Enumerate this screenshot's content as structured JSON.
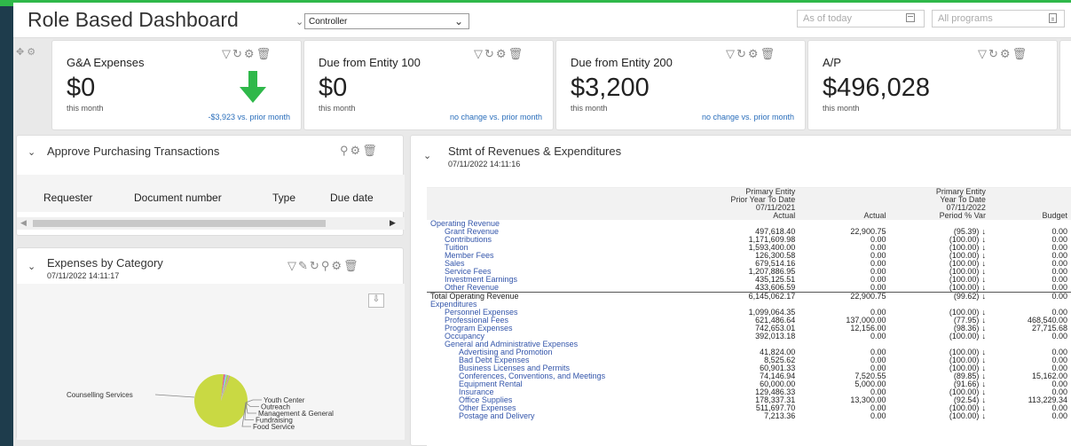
{
  "header": {
    "title": "Role Based Dashboard",
    "role_selected": "Controller",
    "date_placeholder": "As of today",
    "program_placeholder": "All programs"
  },
  "kpis": [
    {
      "title": "G&A Expenses",
      "value": "$0",
      "sub": "this month",
      "comparison": "-$3,923 vs. prior month",
      "trend": "down"
    },
    {
      "title": "Due from Entity 100",
      "value": "$0",
      "sub": "this month",
      "comparison": "no change vs. prior month"
    },
    {
      "title": "Due from Entity 200",
      "value": "$3,200",
      "sub": "this month",
      "comparison": "no change vs. prior month"
    },
    {
      "title": "A/P",
      "value": "$496,028",
      "sub": "this month",
      "comparison": ""
    }
  ],
  "approve_panel": {
    "title": "Approve Purchasing Transactions",
    "columns": [
      "Requester",
      "Document number",
      "Type",
      "Due date"
    ]
  },
  "expenses_panel": {
    "title": "Expenses by Category",
    "timestamp": "07/11/2022 14:11:17",
    "chart_data": {
      "type": "pie",
      "labels": [
        "Counselling Services",
        "Youth Center",
        "Outreach",
        "Management & General",
        "Fundraising",
        "Food Service"
      ],
      "values": [
        96,
        1,
        1,
        1,
        0.5,
        0.5
      ],
      "colors": [
        "#c9d943",
        "#e05a8a",
        "#8ec8f0",
        "#9fd15a",
        "#f0b24a",
        "#b07fd0"
      ]
    }
  },
  "stmt_panel": {
    "title": "Stmt of Revenues & Expenditures",
    "timestamp": "07/11/2022 14:11:16",
    "col_headers": {
      "c1": [
        "Primary Entity",
        "Prior Year To Date",
        "07/11/2021",
        "Actual"
      ],
      "c2": [
        "",
        "",
        "",
        "Actual"
      ],
      "c3": [
        "Primary Entity",
        "Year To Date",
        "07/11/2022",
        "Period % Var"
      ],
      "c4": [
        "",
        "",
        "",
        "Budget"
      ]
    },
    "rows": [
      {
        "label": "Operating Revenue",
        "indent": 0,
        "link": true,
        "c1": "",
        "c2": "",
        "c3": "",
        "c4": ""
      },
      {
        "label": "Grant Revenue",
        "indent": 1,
        "link": true,
        "c1": "497,618.40",
        "c2": "22,900.75",
        "c3": "(95.39)",
        "c4": "0.00",
        "arrow": true
      },
      {
        "label": "Contributions",
        "indent": 1,
        "link": true,
        "c1": "1,171,609.98",
        "c2": "0.00",
        "c3": "(100.00)",
        "c4": "0.00",
        "arrow": true
      },
      {
        "label": "Tuition",
        "indent": 1,
        "link": true,
        "c1": "1,593,400.00",
        "c2": "0.00",
        "c3": "(100.00)",
        "c4": "0.00",
        "arrow": true
      },
      {
        "label": "Member Fees",
        "indent": 1,
        "link": true,
        "c1": "126,300.58",
        "c2": "0.00",
        "c3": "(100.00)",
        "c4": "0.00",
        "arrow": true
      },
      {
        "label": "Sales",
        "indent": 1,
        "link": true,
        "c1": "679,514.16",
        "c2": "0.00",
        "c3": "(100.00)",
        "c4": "0.00",
        "arrow": true
      },
      {
        "label": "Service Fees",
        "indent": 1,
        "link": true,
        "c1": "1,207,886.95",
        "c2": "0.00",
        "c3": "(100.00)",
        "c4": "0.00",
        "arrow": true
      },
      {
        "label": "Investment Earnings",
        "indent": 1,
        "link": true,
        "c1": "435,125.51",
        "c2": "0.00",
        "c3": "(100.00)",
        "c4": "0.00",
        "arrow": true
      },
      {
        "label": "Other Revenue",
        "indent": 1,
        "link": true,
        "c1": "433,606.59",
        "c2": "0.00",
        "c3": "(100.00)",
        "c4": "0.00",
        "arrow": true
      },
      {
        "label": "Total Operating Revenue",
        "indent": 0,
        "link": false,
        "total": true,
        "c1": "6,145,062.17",
        "c2": "22,900.75",
        "c3": "(99.62)",
        "c4": "0.00",
        "arrow": true
      },
      {
        "label": "Expenditures",
        "indent": 0,
        "link": true,
        "c1": "",
        "c2": "",
        "c3": "",
        "c4": ""
      },
      {
        "label": "Personnel Expenses",
        "indent": 1,
        "link": true,
        "c1": "1,099,064.35",
        "c2": "0.00",
        "c3": "(100.00)",
        "c4": "0.00",
        "arrow": true
      },
      {
        "label": "Professional Fees",
        "indent": 1,
        "link": true,
        "c1": "621,486.64",
        "c2": "137,000.00",
        "c3": "(77.95)",
        "c4": "468,540.00",
        "arrow": true
      },
      {
        "label": "Program Expenses",
        "indent": 1,
        "link": true,
        "c1": "742,653.01",
        "c2": "12,156.00",
        "c3": "(98.36)",
        "c4": "27,715.68",
        "arrow": true
      },
      {
        "label": "Occupancy",
        "indent": 1,
        "link": true,
        "c1": "392,013.18",
        "c2": "0.00",
        "c3": "(100.00)",
        "c4": "0.00",
        "arrow": true
      },
      {
        "label": "General and Administrative Expenses",
        "indent": 1,
        "link": true,
        "c1": "",
        "c2": "",
        "c3": "",
        "c4": ""
      },
      {
        "label": "Advertising and Promotion",
        "indent": 2,
        "link": true,
        "c1": "41,824.00",
        "c2": "0.00",
        "c3": "(100.00)",
        "c4": "0.00",
        "arrow": true
      },
      {
        "label": "Bad Debt Expenses",
        "indent": 2,
        "link": true,
        "c1": "8,525.62",
        "c2": "0.00",
        "c3": "(100.00)",
        "c4": "0.00",
        "arrow": true
      },
      {
        "label": "Business Licenses and Permits",
        "indent": 2,
        "link": true,
        "c1": "60,901.33",
        "c2": "0.00",
        "c3": "(100.00)",
        "c4": "0.00",
        "arrow": true
      },
      {
        "label": "Conferences, Conventions, and Meetings",
        "indent": 2,
        "link": true,
        "c1": "74,146.94",
        "c2": "7,520.55",
        "c3": "(89.85)",
        "c4": "15,162.00",
        "arrow": true
      },
      {
        "label": "Equipment Rental",
        "indent": 2,
        "link": true,
        "c1": "60,000.00",
        "c2": "5,000.00",
        "c3": "(91.66)",
        "c4": "0.00",
        "arrow": true
      },
      {
        "label": "Insurance",
        "indent": 2,
        "link": true,
        "c1": "129,486.33",
        "c2": "0.00",
        "c3": "(100.00)",
        "c4": "0.00",
        "arrow": true
      },
      {
        "label": "Office Supplies",
        "indent": 2,
        "link": true,
        "c1": "178,337.31",
        "c2": "13,300.00",
        "c3": "(92.54)",
        "c4": "113,229.34",
        "arrow": true
      },
      {
        "label": "Other Expenses",
        "indent": 2,
        "link": true,
        "c1": "511,697.70",
        "c2": "0.00",
        "c3": "(100.00)",
        "c4": "0.00",
        "arrow": true
      },
      {
        "label": "Postage and Delivery",
        "indent": 2,
        "link": true,
        "c1": "7,213.36",
        "c2": "0.00",
        "c3": "(100.00)",
        "c4": "0.00",
        "arrow": true
      }
    ]
  }
}
